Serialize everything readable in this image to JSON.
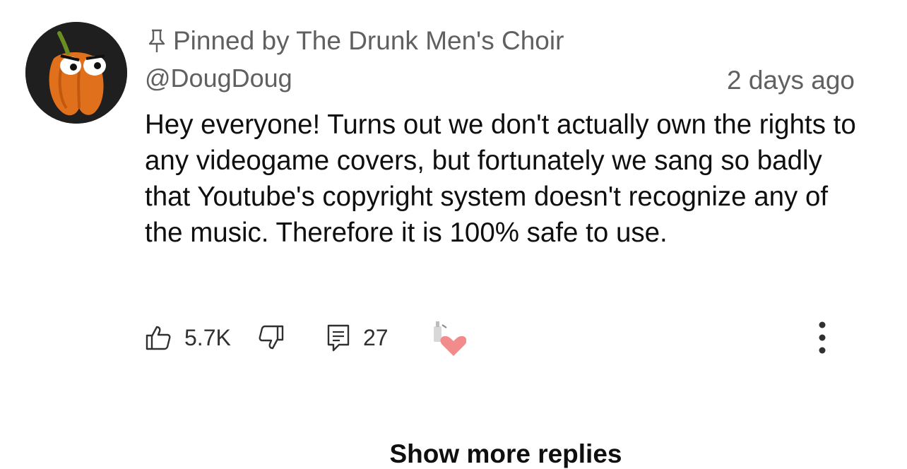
{
  "comment": {
    "pinned_label": "Pinned by The Drunk Men's Choir",
    "author": "@DougDoug",
    "timestamp": "2 days ago",
    "text": "Hey everyone! Turns out we don't actually own the rights to any videogame covers, but fortunately we sang so badly that Youtube's copyright system doesn't recognize any of the music. Therefore it is 100% safe to use.",
    "avatar_icon": "orange-bell-pepper-avatar",
    "actions": {
      "like_icon": "thumbs-up-icon",
      "like_count": "5.7K",
      "dislike_icon": "thumbs-down-icon",
      "reply_icon": "comment-icon",
      "reply_count": "27",
      "creator_heart_icon": "creator-heart-icon",
      "more_icon": "more-vertical-icon"
    }
  },
  "show_more_replies": "Show more replies",
  "colors": {
    "secondary_text": "#606060",
    "primary_text": "#0f0f0f",
    "heart": "#f28b8b"
  }
}
